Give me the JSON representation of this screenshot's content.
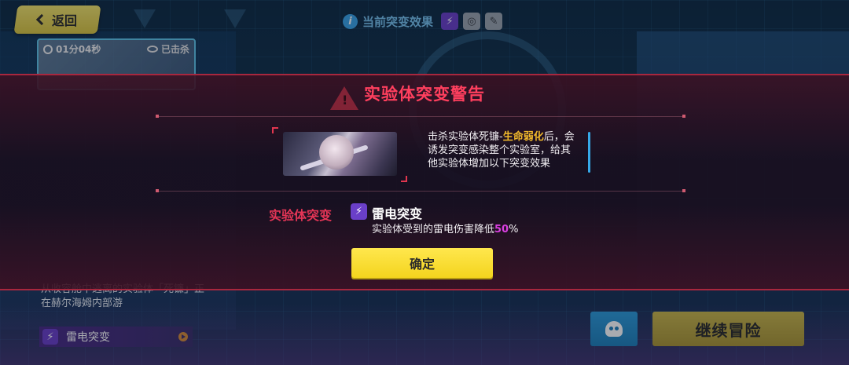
{
  "colors": {
    "accent_red": "#ff3f5e",
    "highlight_gold": "#f1b92b",
    "percent_magenta": "#d93fe0",
    "confirm_yellow": "#ffe74d",
    "lightning_purple": "#6a3fc8"
  },
  "top_bar": {
    "back_label": "返回",
    "mutation_effect_title": "当前突变效果",
    "effect_icons": [
      "lightning-icon",
      "swirl-icon",
      "sword-icon"
    ]
  },
  "left_panel": {
    "timer": "01分04秒",
    "killed_label": "已击杀",
    "boss_description": "从收容舱中逃离的实验体「死镰」正在赫尔海姆内部游",
    "mutation_row_label": "雷电突变"
  },
  "bottom": {
    "continue_label": "继续冒险"
  },
  "modal": {
    "title": "实验体突变警告",
    "desc_prefix": "击杀实验体死镰-",
    "desc_highlight": "生命弱化",
    "desc_suffix": "后，会诱发突变感染整个实验室，给其他实验体增加以下突变效果",
    "mutation_label": "实验体突变",
    "mutation_name": "雷电突变",
    "effect_prefix": "实验体受到的雷电伤害降低",
    "effect_value": "50",
    "effect_unit": "%",
    "confirm_label": "确定"
  }
}
